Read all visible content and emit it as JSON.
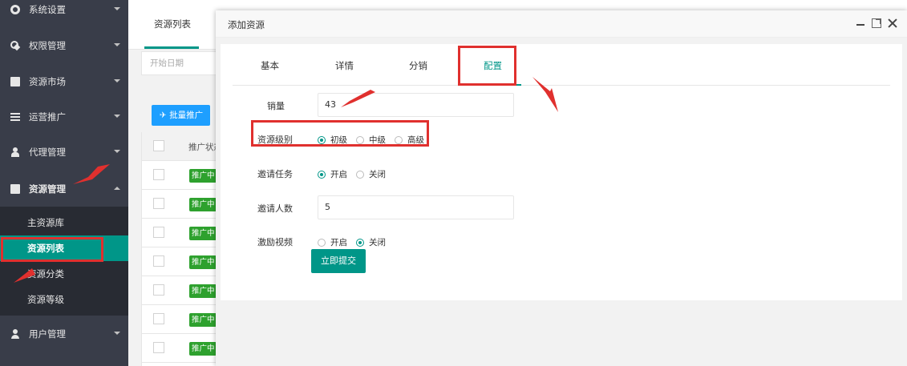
{
  "sidebar": {
    "items": [
      {
        "label": "系统设置",
        "icon": "gear-icon"
      },
      {
        "label": "权限管理",
        "icon": "key-icon"
      },
      {
        "label": "资源市场",
        "icon": "book-icon"
      },
      {
        "label": "运营推广",
        "icon": "list-icon"
      },
      {
        "label": "代理管理",
        "icon": "people-icon"
      },
      {
        "label": "资源管理",
        "icon": "book-icon",
        "expanded": true
      },
      {
        "label": "用户管理",
        "icon": "user-icon"
      }
    ],
    "subitems": [
      {
        "label": "主资源库"
      },
      {
        "label": "资源列表",
        "active": true
      },
      {
        "label": "资源分类"
      },
      {
        "label": "资源等级"
      }
    ]
  },
  "background_page": {
    "tab": "资源列表",
    "date_placeholder": "开始日期",
    "batch_button": "批量推广",
    "table_header": "推广状态",
    "badges": [
      "推广中",
      "推广中",
      "推广中",
      "推广中",
      "推广中",
      "推广中",
      "推广中"
    ]
  },
  "dialog": {
    "title": "添加资源",
    "tabs": [
      {
        "label": "基本"
      },
      {
        "label": "详情"
      },
      {
        "label": "分销"
      },
      {
        "label": "配置",
        "active": true
      }
    ],
    "fields": {
      "sales": {
        "label": "销量",
        "value": "43"
      },
      "level": {
        "label": "资源级别",
        "options": [
          "初级",
          "中级",
          "高级"
        ],
        "selected": "初级"
      },
      "invite_task": {
        "label": "邀请任务",
        "options": [
          "开启",
          "关闭"
        ],
        "selected": "开启"
      },
      "invite_count": {
        "label": "邀请人数",
        "value": "5"
      },
      "reward_video": {
        "label": "激励视频",
        "options": [
          "开启",
          "关闭"
        ],
        "selected": "关闭"
      }
    },
    "submit_label": "立即提交"
  },
  "colors": {
    "sidebar_bg": "#393d49",
    "accent": "#009688",
    "badge_green": "#2ea12e",
    "batch_blue": "#1e9fff",
    "annotation_red": "#e0302e"
  }
}
